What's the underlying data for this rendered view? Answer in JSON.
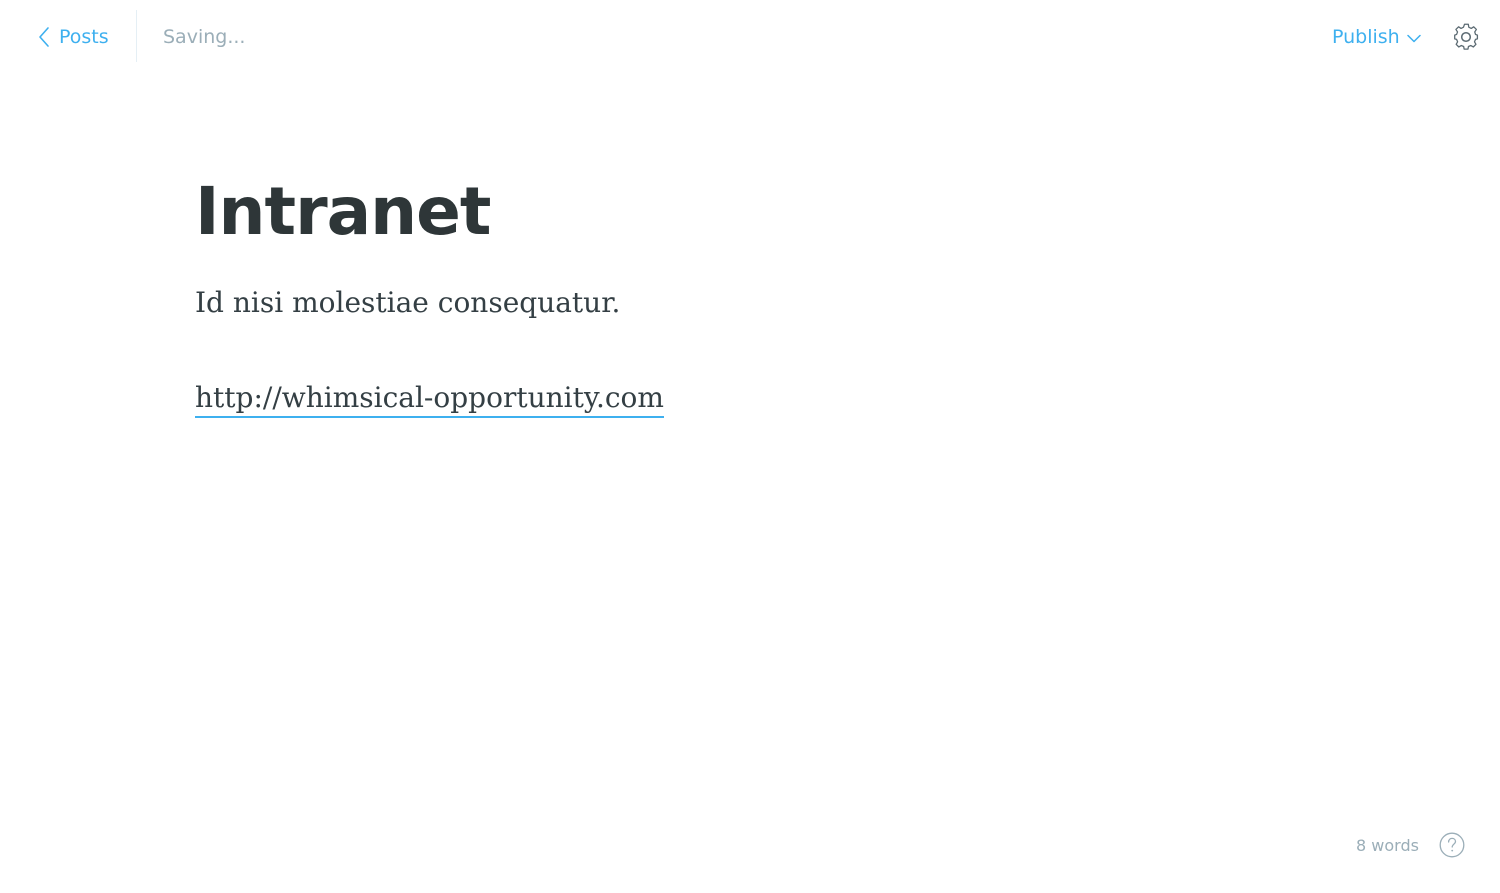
{
  "header": {
    "back_label": "Posts",
    "status": "Saving...",
    "publish_label": "Publish"
  },
  "post": {
    "title": "Intranet",
    "paragraph": "Id nisi molestiae consequatur.",
    "link_text": "http://whimsical-opportunity.com"
  },
  "footer": {
    "word_count": "8 words"
  },
  "icons": {
    "back": "chevron-left-icon",
    "publish_dropdown": "chevron-down-icon",
    "settings": "gear-icon",
    "help": "question-icon"
  },
  "colors": {
    "accent": "#3eb0ef",
    "title": "#2e3638",
    "body_text": "#343f44",
    "muted": "#9baeb8"
  }
}
